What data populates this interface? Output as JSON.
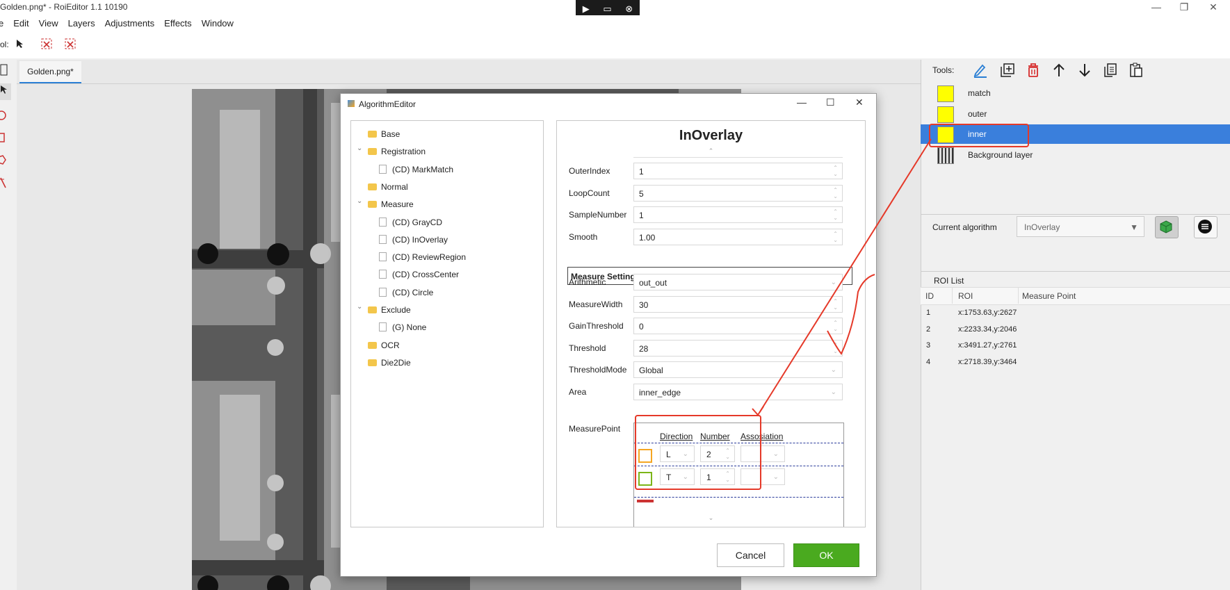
{
  "window": {
    "title": "Golden.png* - RoiEditor 1.1 10190",
    "min": "—",
    "restore": "❐",
    "close": "✕"
  },
  "remote_toolbar": {
    "pointer": "▶",
    "screen": "▭",
    "close": "⊗"
  },
  "menu": [
    "e",
    "Edit",
    "View",
    "Layers",
    "Adjustments",
    "Effects",
    "Window"
  ],
  "toolrow": {
    "label": "ol:"
  },
  "document": {
    "tab": "Golden.png*"
  },
  "dialog": {
    "title": "AlgorithmEditor",
    "tree": [
      {
        "label": "Base",
        "type": "folder",
        "level": 0
      },
      {
        "label": "Registration",
        "type": "folder",
        "level": 0,
        "expanded": true
      },
      {
        "label": "(CD) MarkMatch",
        "type": "file",
        "level": 1
      },
      {
        "label": "Normal",
        "type": "folder",
        "level": 0
      },
      {
        "label": "Measure",
        "type": "folder",
        "level": 0,
        "expanded": true
      },
      {
        "label": "(CD) GrayCD",
        "type": "file",
        "level": 1
      },
      {
        "label": "(CD) InOverlay",
        "type": "file",
        "level": 1
      },
      {
        "label": "(CD) ReviewRegion",
        "type": "file",
        "level": 1
      },
      {
        "label": "(CD) CrossCenter",
        "type": "file",
        "level": 1
      },
      {
        "label": "(CD) Circle",
        "type": "file",
        "level": 1
      },
      {
        "label": "Exclude",
        "type": "folder",
        "level": 0,
        "expanded": true
      },
      {
        "label": "(G) None",
        "type": "file",
        "level": 1
      },
      {
        "label": "OCR",
        "type": "folder",
        "level": 0
      },
      {
        "label": "Die2Die",
        "type": "folder",
        "level": 0
      }
    ],
    "props_title": "InOverlay",
    "fields": [
      {
        "label": "OuterIndex",
        "value": "1",
        "kind": "spin"
      },
      {
        "label": "LoopCount",
        "value": "5",
        "kind": "spin"
      },
      {
        "label": "SampleNumber",
        "value": "1",
        "kind": "spin"
      },
      {
        "label": "Smooth",
        "value": "1.00",
        "kind": "spin"
      }
    ],
    "section": "Measure Settings",
    "fields2": [
      {
        "label": "Arithmetic",
        "value": "out_out",
        "kind": "dropdown"
      },
      {
        "label": "MeasureWidth",
        "value": "30",
        "kind": "spin"
      },
      {
        "label": "GainThreshold",
        "value": "0",
        "kind": "spin"
      },
      {
        "label": "Threshold",
        "value": "28",
        "kind": "spin"
      },
      {
        "label": "ThresholdMode",
        "value": "Global",
        "kind": "dropdown"
      },
      {
        "label": "Area",
        "value": "inner_edge",
        "kind": "dropdown"
      }
    ],
    "measure_point": {
      "label": "MeasurePoint",
      "headers": [
        "Direction",
        "Number",
        "Assosiation"
      ],
      "rows": [
        {
          "color": "#f5a623",
          "direction": "L",
          "number": "2",
          "assoc": ""
        },
        {
          "color": "#7cb518",
          "direction": "T",
          "number": "1",
          "assoc": ""
        }
      ]
    },
    "cancel": "Cancel",
    "ok": "OK"
  },
  "right_panel": {
    "tools_label": "Tools:",
    "layers": [
      {
        "name": "match",
        "selected": false
      },
      {
        "name": "outer",
        "selected": false
      },
      {
        "name": "inner",
        "selected": true
      },
      {
        "name": "Background layer",
        "selected": false,
        "background": true
      }
    ],
    "current_algorithm_label": "Current algorithm",
    "current_algorithm": "InOverlay",
    "roi_list_label": "ROI List",
    "roi_headers": [
      "ID",
      "ROI",
      "Measure Point"
    ],
    "roi_rows": [
      {
        "id": "1",
        "roi": "x:1753.63,y:2627"
      },
      {
        "id": "2",
        "roi": "x:2233.34,y:2046"
      },
      {
        "id": "3",
        "roi": "x:3491.27,y:2761"
      },
      {
        "id": "4",
        "roi": "x:2718.39,y:3464"
      }
    ]
  },
  "colors": {
    "accent": "#2a7fd4",
    "selection": "#3a7fdc",
    "ok_green": "#4aaa1f",
    "annotation_red": "#e53929",
    "layer_yellow": "#ffff00"
  }
}
